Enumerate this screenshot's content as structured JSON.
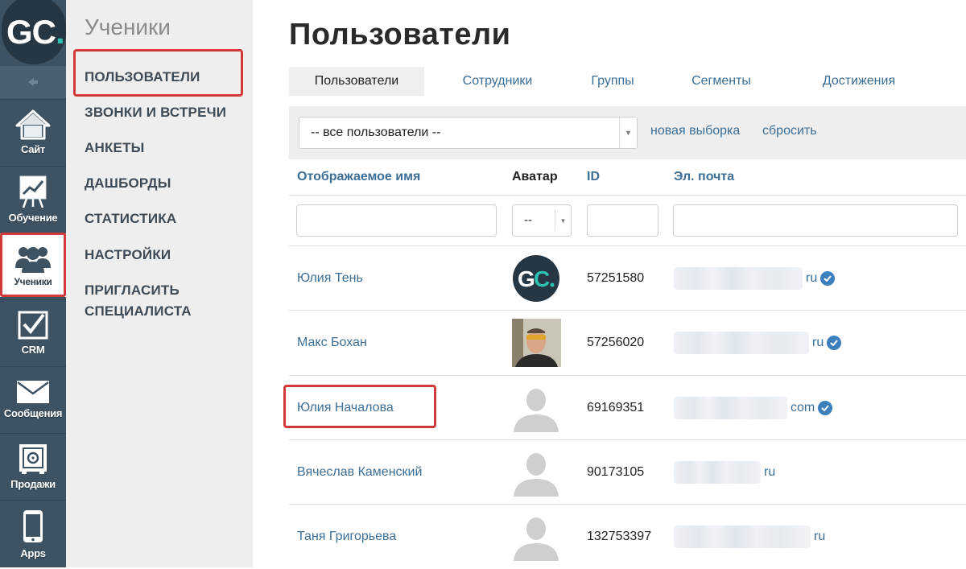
{
  "app": {
    "logo_text_main": "GC",
    "logo_text_dot": "."
  },
  "rail": {
    "items": [
      {
        "label": "Сайт",
        "icon": "home-icon"
      },
      {
        "label": "Обучение",
        "icon": "chart-icon"
      },
      {
        "label": "Ученики",
        "icon": "users-icon"
      },
      {
        "label": "CRM",
        "icon": "checkbox-icon"
      },
      {
        "label": "Сообщения",
        "icon": "envelope-icon"
      },
      {
        "label": "Продажи",
        "icon": "safe-icon"
      },
      {
        "label": "Apps",
        "icon": "phone-icon"
      }
    ],
    "active_label": "Ученики"
  },
  "menu": {
    "title": "Ученики",
    "items": [
      {
        "label": "ПОЛЬЗОВАТЕЛИ"
      },
      {
        "label": "ЗВОНКИ И ВСТРЕЧИ"
      },
      {
        "label": "АНКЕТЫ"
      },
      {
        "label": "ДАШБОРДЫ"
      },
      {
        "label": "СТАТИСТИКА"
      },
      {
        "label": "НАСТРОЙКИ"
      },
      {
        "label": "ПРИГЛАСИТЬ"
      },
      {
        "label": "СПЕЦИАЛИСТА"
      }
    ]
  },
  "main": {
    "title": "Пользователи",
    "tabs": [
      {
        "label": "Пользователи"
      },
      {
        "label": "Сотрудники"
      },
      {
        "label": "Группы"
      },
      {
        "label": "Сегменты"
      },
      {
        "label": "Достижения"
      }
    ],
    "filter": {
      "selected": "-- все пользователи --",
      "new_selection": "новая выборка",
      "reset": "сбросить"
    },
    "columns": {
      "name": "Отображаемое имя",
      "avatar": "Аватар",
      "id": "ID",
      "email": "Эл. почта"
    },
    "avatar_filter_value": "--",
    "rows": [
      {
        "name": "Юлия Тень",
        "id": "57251580",
        "email_domain": "ru",
        "verified": true,
        "avatar": "gc-logo"
      },
      {
        "name": "Макс Бохан",
        "id": "57256020",
        "email_domain": "ru",
        "verified": true,
        "avatar": "photo"
      },
      {
        "name": "Юлия Началова",
        "id": "69169351",
        "email_domain": "com",
        "verified": true,
        "avatar": "placeholder"
      },
      {
        "name": "Вячеслав Каменский",
        "id": "90173105",
        "email_domain": "ru",
        "verified": false,
        "avatar": "placeholder"
      },
      {
        "name": "Таня Григорьева",
        "id": "132753397",
        "email_domain": "ru",
        "verified": false,
        "avatar": "placeholder"
      }
    ]
  },
  "colors": {
    "rail_bg": "#3d5263",
    "accent_teal": "#2ec1b2",
    "link_blue": "#3c6e96",
    "highlight_red": "#d23a3a"
  }
}
